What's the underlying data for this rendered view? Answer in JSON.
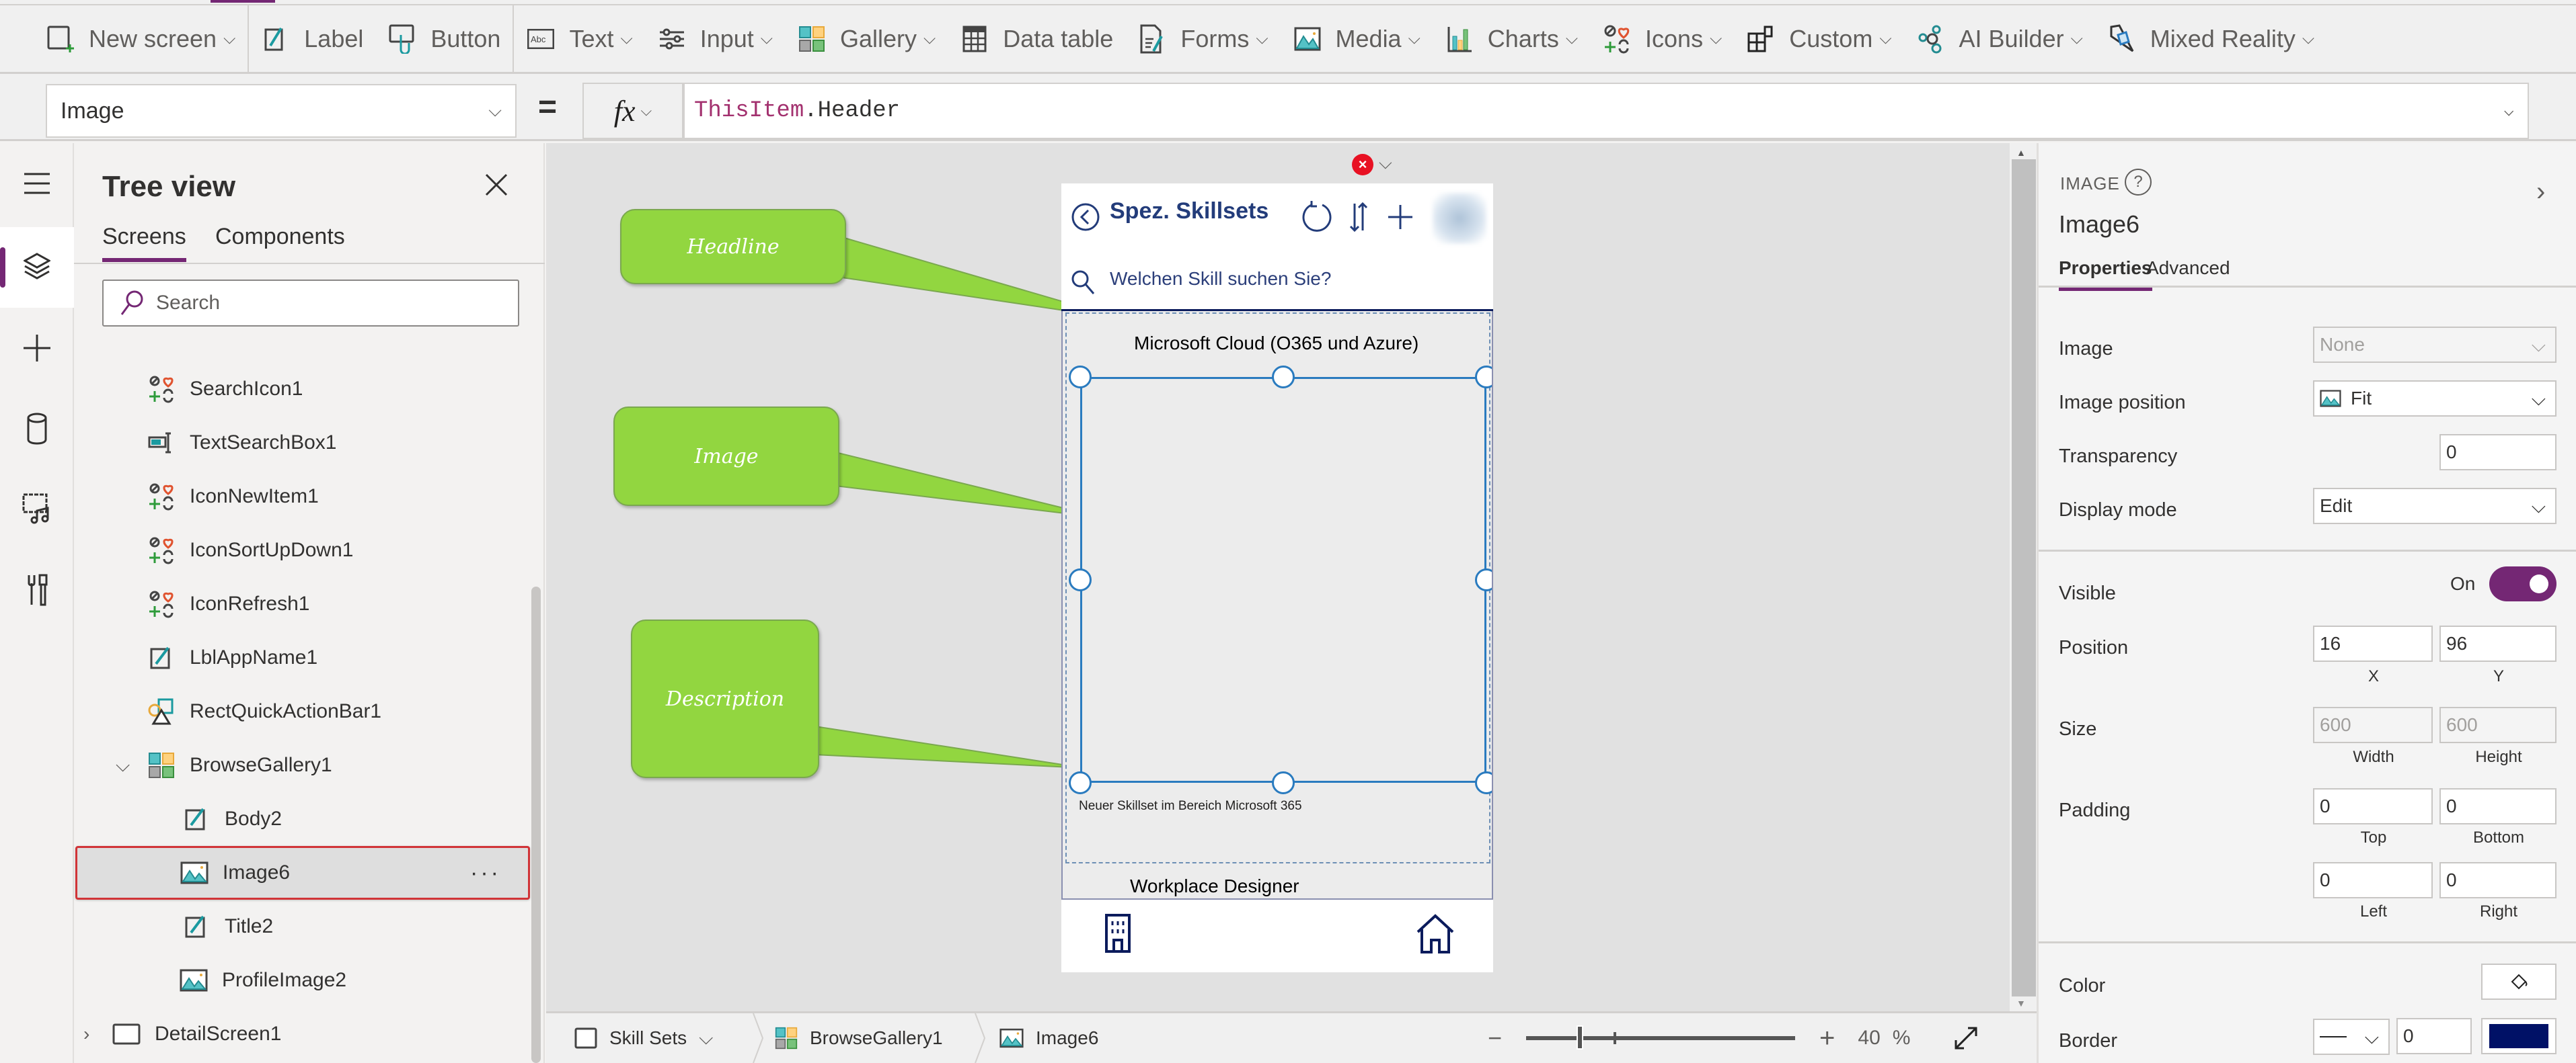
{
  "toolbar": {
    "items": [
      {
        "label": "New screen",
        "icon": "new-screen-icon",
        "dropdown": true
      },
      {
        "label": "Label",
        "icon": "label-icon",
        "dropdown": false
      },
      {
        "label": "Button",
        "icon": "button-icon",
        "dropdown": false
      },
      {
        "label": "Text",
        "icon": "text-icon",
        "dropdown": true
      },
      {
        "label": "Input",
        "icon": "input-icon",
        "dropdown": true
      },
      {
        "label": "Gallery",
        "icon": "gallery-icon",
        "dropdown": true
      },
      {
        "label": "Data table",
        "icon": "data-table-icon",
        "dropdown": false
      },
      {
        "label": "Forms",
        "icon": "forms-icon",
        "dropdown": true
      },
      {
        "label": "Media",
        "icon": "media-icon",
        "dropdown": true
      },
      {
        "label": "Charts",
        "icon": "charts-icon",
        "dropdown": true
      },
      {
        "label": "Icons",
        "icon": "icons-icon",
        "dropdown": true
      },
      {
        "label": "Custom",
        "icon": "custom-icon",
        "dropdown": true
      },
      {
        "label": "AI Builder",
        "icon": "ai-builder-icon",
        "dropdown": true
      },
      {
        "label": "Mixed Reality",
        "icon": "mixed-reality-icon",
        "dropdown": true
      }
    ]
  },
  "formula_bar": {
    "property": "Image",
    "equals": "=",
    "fx_label": "fx",
    "formula_keyword": "ThisItem",
    "formula_rest": ".Header"
  },
  "tree_view": {
    "title": "Tree view",
    "tabs": [
      "Screens",
      "Components"
    ],
    "active_tab": "Screens",
    "search_placeholder": "Search",
    "items": [
      {
        "label": "SearchIcon1",
        "icon": "icons-icon",
        "level": 2
      },
      {
        "label": "TextSearchBox1",
        "icon": "text-input-icon",
        "level": 2
      },
      {
        "label": "IconNewItem1",
        "icon": "icons-icon",
        "level": 2
      },
      {
        "label": "IconSortUpDown1",
        "icon": "icons-icon",
        "level": 2
      },
      {
        "label": "IconRefresh1",
        "icon": "icons-icon",
        "level": 2
      },
      {
        "label": "LblAppName1",
        "icon": "label-icon",
        "level": 2
      },
      {
        "label": "RectQuickActionBar1",
        "icon": "shapes-icon",
        "level": 2
      },
      {
        "label": "BrowseGallery1",
        "icon": "gallery-icon",
        "level": 2,
        "expanded": true
      },
      {
        "label": "Body2",
        "icon": "label-icon",
        "level": 3
      },
      {
        "label": "Image6",
        "icon": "image-icon",
        "level": 3,
        "selected": true,
        "more": "···"
      },
      {
        "label": "Title2",
        "icon": "label-icon",
        "level": 3
      },
      {
        "label": "ProfileImage2",
        "icon": "image-icon",
        "level": 3
      },
      {
        "label": "DetailScreen1",
        "icon": "screen-icon",
        "level": 1,
        "expanded": false
      }
    ]
  },
  "canvas": {
    "phone": {
      "title": "Spez. Skillsets",
      "search_placeholder": "Welchen Skill suchen Sie?",
      "gallery_items": [
        {
          "title": "Microsoft Cloud (O365 und Azure)",
          "description": "Neuer Skillset im Bereich Microsoft 365"
        },
        {
          "title": "Workplace Designer"
        }
      ],
      "error_badge": "×"
    },
    "callouts": [
      {
        "label": "Headline"
      },
      {
        "label": "Image"
      },
      {
        "label": "Description"
      }
    ]
  },
  "status_bar": {
    "breadcrumbs": [
      {
        "label": "Skill Sets",
        "icon": "screen-icon",
        "dropdown": true
      },
      {
        "label": "BrowseGallery1",
        "icon": "gallery-icon"
      },
      {
        "label": "Image6",
        "icon": "image-icon"
      }
    ],
    "zoom_minus": "−",
    "zoom_plus": "+",
    "zoom_value": "40",
    "zoom_unit": "%",
    "zoom_fraction": 0.2
  },
  "properties": {
    "type_label": "IMAGE",
    "control_name": "Image6",
    "tabs": [
      "Properties",
      "Advanced"
    ],
    "active_tab": "Properties",
    "image": {
      "label": "Image",
      "value": "None"
    },
    "image_position": {
      "label": "Image position",
      "value": "Fit"
    },
    "transparency": {
      "label": "Transparency",
      "value": "0"
    },
    "display_mode": {
      "label": "Display mode",
      "value": "Edit"
    },
    "visible": {
      "label": "Visible",
      "state_label": "On",
      "on": true
    },
    "position": {
      "label": "Position",
      "x": "16",
      "y": "96",
      "x_label": "X",
      "y_label": "Y"
    },
    "size": {
      "label": "Size",
      "width": "600",
      "height": "600",
      "width_label": "Width",
      "height_label": "Height"
    },
    "padding": {
      "label": "Padding",
      "top": "0",
      "bottom": "0",
      "left": "0",
      "right": "0",
      "top_label": "Top",
      "bottom_label": "Bottom",
      "left_label": "Left",
      "right_label": "Right"
    },
    "color": {
      "label": "Color"
    },
    "border": {
      "label": "Border",
      "width": "0",
      "color": "#001166"
    }
  },
  "colors": {
    "accent": "#742774",
    "selection_red": "#d13438",
    "phone_navy": "#233c7a",
    "callout_green": "#92d640",
    "handle_blue": "#2a7bbf"
  }
}
